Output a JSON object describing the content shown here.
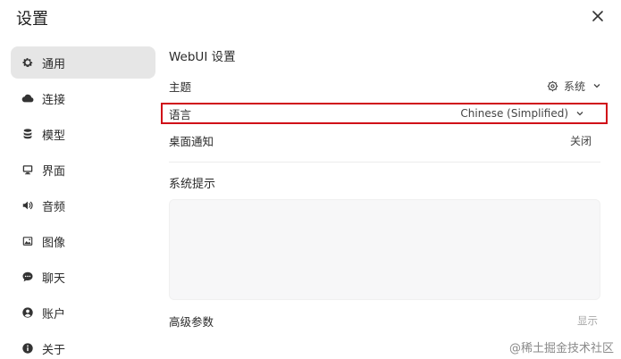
{
  "window": {
    "title": "设置"
  },
  "sidebar": {
    "items": [
      {
        "label": "通用",
        "icon": "gear-icon",
        "active": true
      },
      {
        "label": "连接",
        "icon": "cloud-icon",
        "active": false
      },
      {
        "label": "模型",
        "icon": "database-icon",
        "active": false
      },
      {
        "label": "界面",
        "icon": "monitor-icon",
        "active": false
      },
      {
        "label": "音频",
        "icon": "speaker-icon",
        "active": false
      },
      {
        "label": "图像",
        "icon": "image-icon",
        "active": false
      },
      {
        "label": "聊天",
        "icon": "chat-bubble-icon",
        "active": false
      },
      {
        "label": "账户",
        "icon": "user-icon",
        "active": false
      },
      {
        "label": "关于",
        "icon": "info-icon",
        "active": false
      }
    ]
  },
  "main": {
    "section_title": "WebUI 设置",
    "theme": {
      "label": "主题",
      "value": "系统"
    },
    "language": {
      "label": "语言",
      "value": "Chinese (Simplified)"
    },
    "notifications": {
      "label": "桌面通知",
      "value": "关闭"
    },
    "system_prompt": {
      "label": "系统提示",
      "value": ""
    },
    "advanced": {
      "label": "高级参数",
      "toggle": "显示"
    }
  },
  "watermark": "@稀土掘金技术社区",
  "colors": {
    "highlight": "#d00d18",
    "active_bg": "#e6e6e6"
  }
}
